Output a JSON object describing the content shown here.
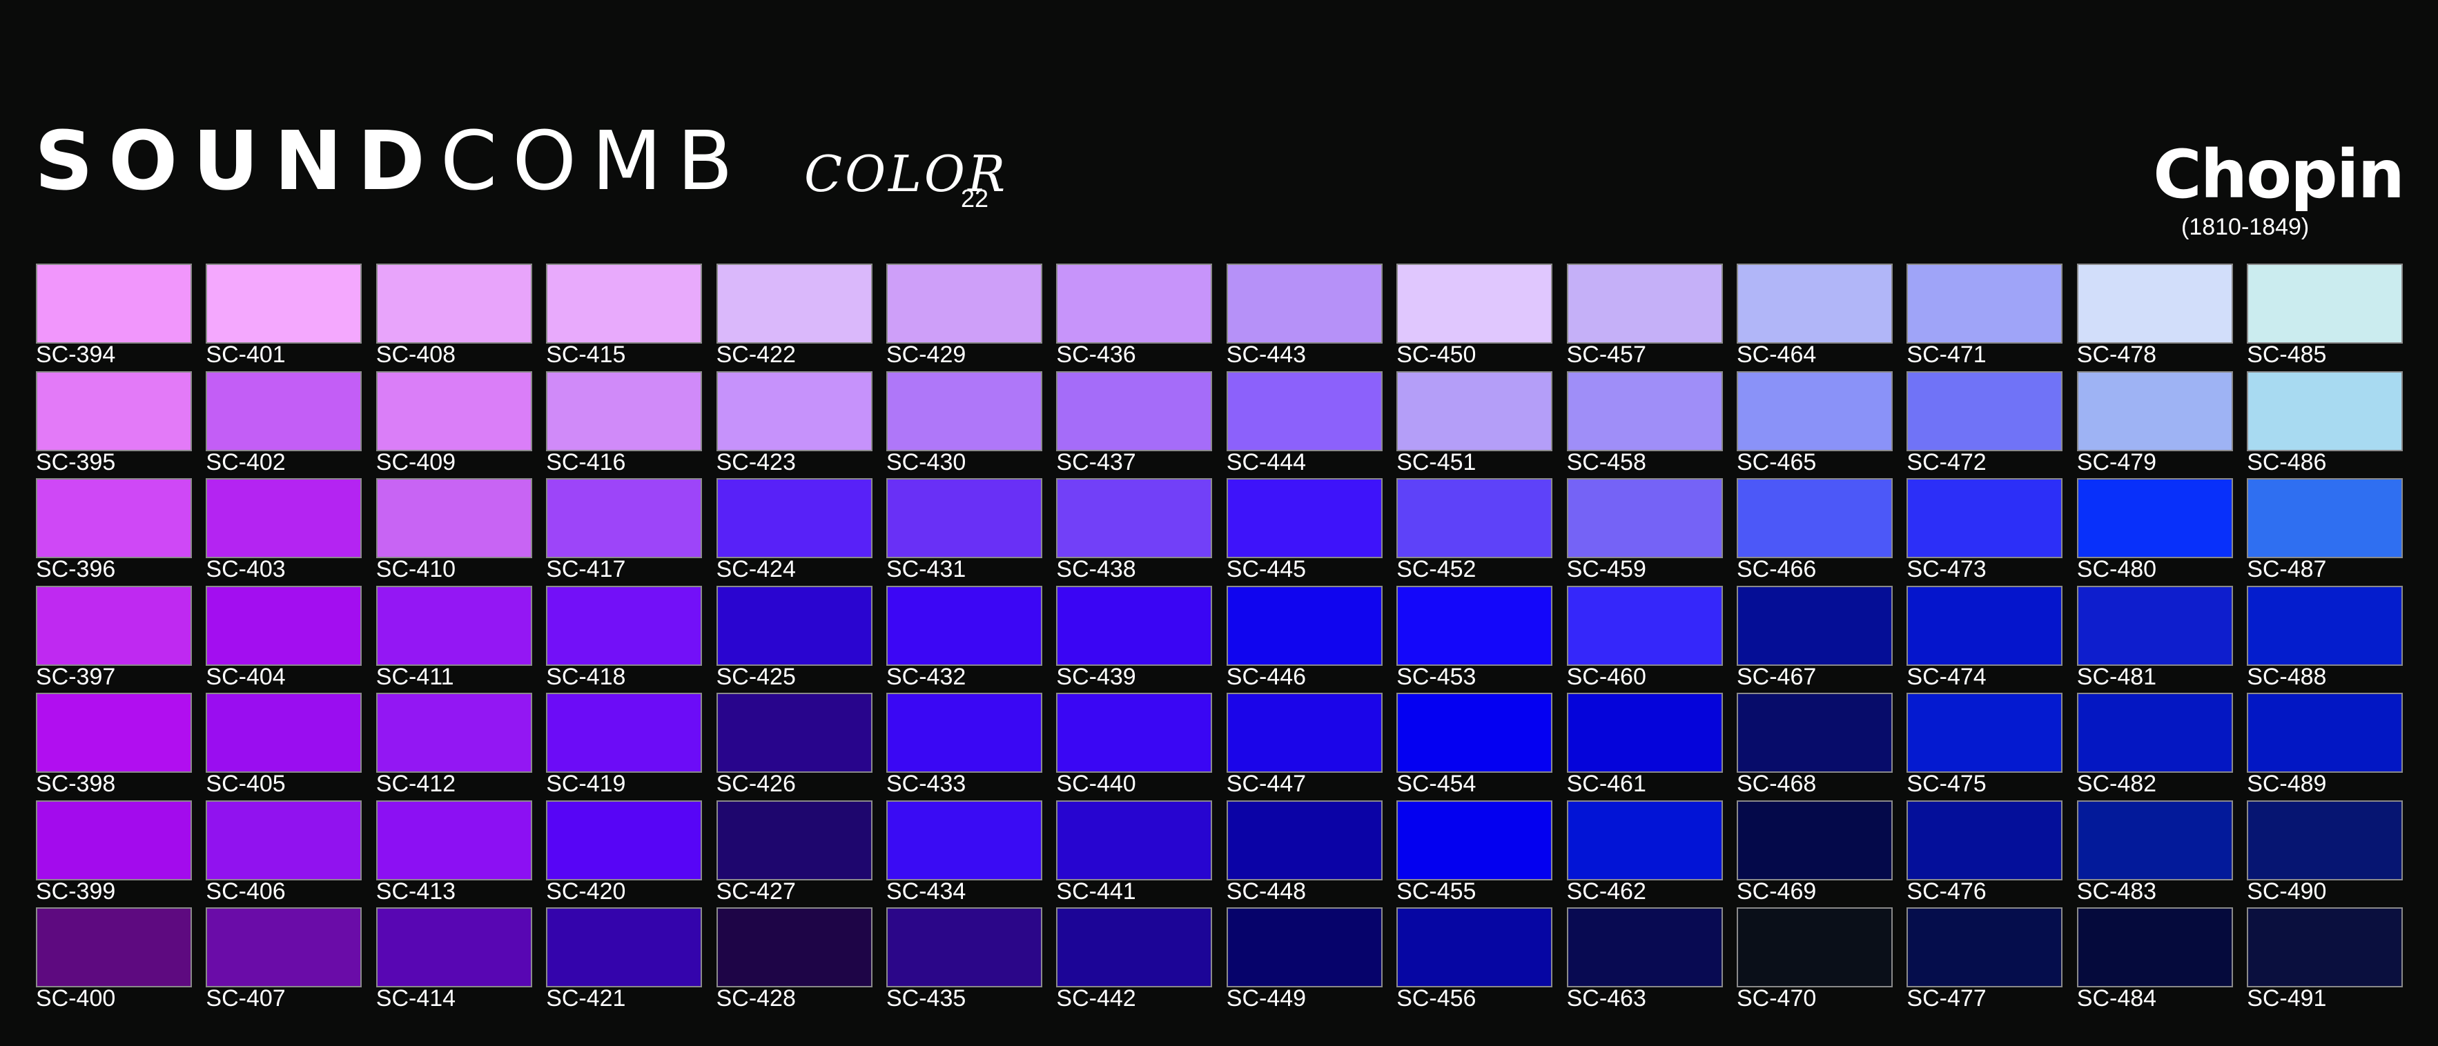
{
  "header": {
    "brand_bold": "SOUND",
    "brand_light": "COMB",
    "brand_sub": "COLOR",
    "brand_sub_number": "22",
    "composer": "Chopin",
    "composer_dates": "(1810-1849)"
  },
  "palette": {
    "columns": [
      {
        "codes": [
          "SC-394",
          "SC-395",
          "SC-396",
          "SC-397",
          "SC-398",
          "SC-399",
          "SC-400"
        ],
        "colors": [
          "#f196fc",
          "#e37af8",
          "#cf48f6",
          "#bf29f1",
          "#b10ef0",
          "#a30bed",
          "#5e0a80"
        ]
      },
      {
        "codes": [
          "SC-401",
          "SC-402",
          "SC-403",
          "SC-404",
          "SC-405",
          "SC-406",
          "SC-407"
        ],
        "colors": [
          "#f4a8fe",
          "#c35ef6",
          "#b424f2",
          "#a30ef0",
          "#9a0df0",
          "#9112ef",
          "#6a0ca8"
        ]
      },
      {
        "codes": [
          "SC-408",
          "SC-409",
          "SC-410",
          "SC-411",
          "SC-412",
          "SC-413",
          "SC-414"
        ],
        "colors": [
          "#e8a4fb",
          "#da7ef8",
          "#c864f4",
          "#9417f4",
          "#9317f3",
          "#8c10f3",
          "#5806b3"
        ]
      },
      {
        "codes": [
          "SC-415",
          "SC-416",
          "SC-417",
          "SC-418",
          "SC-419",
          "SC-420",
          "SC-421"
        ],
        "colors": [
          "#e8aafc",
          "#d08af9",
          "#9d45f9",
          "#7310f8",
          "#6c0cf7",
          "#5705f6",
          "#3404ac"
        ]
      },
      {
        "codes": [
          "SC-422",
          "SC-423",
          "SC-424",
          "SC-425",
          "SC-426",
          "SC-427",
          "SC-428"
        ],
        "colors": [
          "#dab8fb",
          "#c692fb",
          "#5821f8",
          "#2a05d0",
          "#28058c",
          "#1e066e",
          "#1e0547"
        ]
      },
      {
        "codes": [
          "SC-429",
          "SC-430",
          "SC-431",
          "SC-432",
          "SC-433",
          "SC-434",
          "SC-435"
        ],
        "colors": [
          "#ce9ff9",
          "#af77f9",
          "#6930f6",
          "#3c06f5",
          "#3a07f4",
          "#3a0bf4",
          "#2b0689"
        ]
      },
      {
        "codes": [
          "SC-436",
          "SC-437",
          "SC-438",
          "SC-439",
          "SC-440",
          "SC-441",
          "SC-442"
        ],
        "colors": [
          "#c794fa",
          "#a56cf9",
          "#7240f8",
          "#3a05f4",
          "#3a06f4",
          "#2705d0",
          "#1c0597"
        ]
      },
      {
        "codes": [
          "SC-443",
          "SC-444",
          "SC-445",
          "SC-446",
          "SC-447",
          "SC-448",
          "SC-449"
        ],
        "colors": [
          "#b691f8",
          "#8c61fb",
          "#3e13fa",
          "#1005ef",
          "#1b05e9",
          "#0b03a6",
          "#06036b"
        ]
      },
      {
        "codes": [
          "SC-450",
          "SC-451",
          "SC-452",
          "SC-453",
          "SC-454",
          "SC-455",
          "SC-456"
        ],
        "colors": [
          "#e0c7fe",
          "#b49ef8",
          "#5e42f9",
          "#1407fa",
          "#0400f2",
          "#0300f0",
          "#0606a3"
        ]
      },
      {
        "codes": [
          "SC-457",
          "SC-458",
          "SC-459",
          "SC-460",
          "SC-461",
          "SC-462",
          "SC-463"
        ],
        "colors": [
          "#c5b0f8",
          "#9f8ef8",
          "#7563f6",
          "#3527fa",
          "#0504da",
          "#0214d6",
          "#080a52"
        ]
      },
      {
        "codes": [
          "SC-464",
          "SC-465",
          "SC-466",
          "SC-467",
          "SC-468",
          "SC-469",
          "SC-470"
        ],
        "colors": [
          "#b1b6f8",
          "#8a92f8",
          "#4c58f8",
          "#050e96",
          "#070c6a",
          "#04094a",
          "#0a0f19"
        ]
      },
      {
        "codes": [
          "SC-471",
          "SC-472",
          "SC-473",
          "SC-474",
          "SC-475",
          "SC-476",
          "SC-477"
        ],
        "colors": [
          "#9fa4f8",
          "#7073f7",
          "#2c2ff8",
          "#0515cc",
          "#041ad0",
          "#040f9a",
          "#050d4c"
        ]
      },
      {
        "codes": [
          "SC-478",
          "SC-479",
          "SC-480",
          "SC-481",
          "SC-482",
          "SC-483",
          "SC-484"
        ],
        "colors": [
          "#d2defa",
          "#9eb3f4",
          "#0830fa",
          "#0e1ecd",
          "#0417c2",
          "#031a9a",
          "#050a3c"
        ]
      },
      {
        "codes": [
          "SC-485",
          "SC-486",
          "SC-487",
          "SC-488",
          "SC-489",
          "SC-490",
          "SC-491"
        ],
        "colors": [
          "#cbecef",
          "#a8daf1",
          "#2f6ff1",
          "#041dcd",
          "#0217c4",
          "#061572",
          "#0a0f3e"
        ]
      }
    ]
  }
}
